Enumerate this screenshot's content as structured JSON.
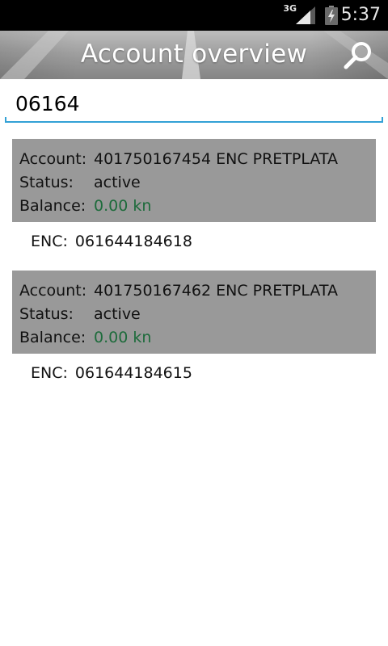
{
  "status_bar": {
    "network": "3G",
    "time": "5:37"
  },
  "action_bar": {
    "title": "Account overview"
  },
  "search": {
    "value": "06164"
  },
  "labels": {
    "account": "Account:",
    "status": "Status:",
    "balance": "Balance:",
    "enc": "ENC:"
  },
  "accounts": [
    {
      "account": "401750167454 ENC PRETPLATA",
      "status": "active",
      "balance": "0.00 kn",
      "enc": "061644184618"
    },
    {
      "account": "401750167462 ENC PRETPLATA",
      "status": "active",
      "balance": "0.00 kn",
      "enc": "061644184615"
    }
  ],
  "colors": {
    "balance_positive": "#1d6b3b",
    "accent": "#33a1d6",
    "card_bg": "#999999"
  }
}
